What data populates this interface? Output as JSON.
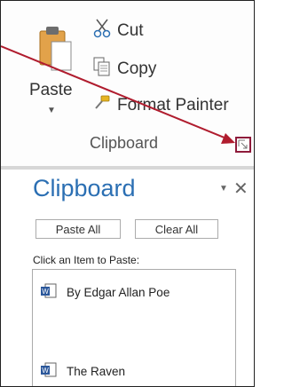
{
  "ribbon": {
    "paste_label": "Paste",
    "cut_label": "Cut",
    "copy_label": "Copy",
    "format_painter_label": "Format Painter",
    "group_label": "Clipboard"
  },
  "pane": {
    "title": "Clipboard",
    "paste_all_label": "Paste All",
    "clear_all_label": "Clear All",
    "prompt": "Click an Item to Paste:",
    "items": [
      {
        "label": "By Edgar Allan Poe",
        "icon": "word-doc-icon"
      },
      {
        "label": "The Raven",
        "icon": "word-doc-icon"
      }
    ]
  },
  "colors": {
    "pane_title": "#2b6fb3",
    "launcher_highlight": "#8e1b3b",
    "arrow": "#b01c2e"
  }
}
